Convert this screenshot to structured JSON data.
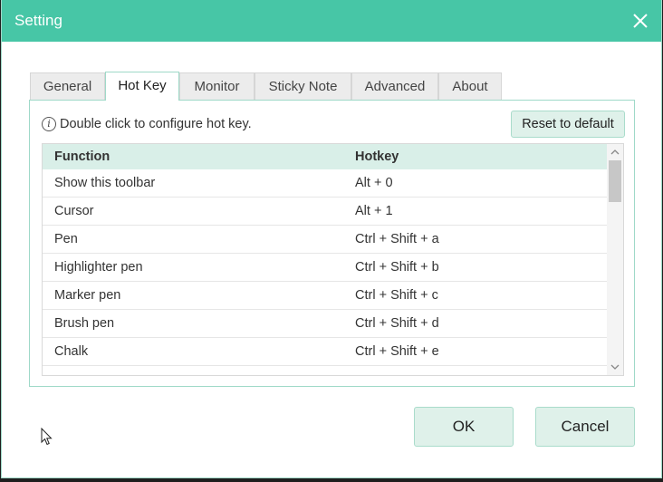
{
  "window": {
    "title": "Setting"
  },
  "tabs": [
    {
      "label": "General",
      "active": false
    },
    {
      "label": "Hot Key",
      "active": true
    },
    {
      "label": "Monitor",
      "active": false
    },
    {
      "label": "Sticky Note",
      "active": false
    },
    {
      "label": "Advanced",
      "active": false
    },
    {
      "label": "About",
      "active": false
    }
  ],
  "hotkey": {
    "hint": "Double click to configure hot key.",
    "reset_label": "Reset to default",
    "columns": [
      "Function",
      "Hotkey"
    ],
    "rows": [
      {
        "function": "Show this toolbar",
        "hotkey": "Alt + 0"
      },
      {
        "function": "Cursor",
        "hotkey": "Alt + 1"
      },
      {
        "function": "Pen",
        "hotkey": "Ctrl + Shift + a"
      },
      {
        "function": "Highlighter pen",
        "hotkey": "Ctrl + Shift + b"
      },
      {
        "function": "Marker pen",
        "hotkey": "Ctrl + Shift + c"
      },
      {
        "function": "Brush pen",
        "hotkey": "Ctrl + Shift + d"
      },
      {
        "function": "Chalk",
        "hotkey": "Ctrl + Shift + e"
      }
    ]
  },
  "buttons": {
    "ok": "OK",
    "cancel": "Cancel"
  },
  "colors": {
    "accent": "#47c6a6",
    "header_row": "#d9efe8",
    "button_bg": "#dff1ea"
  }
}
